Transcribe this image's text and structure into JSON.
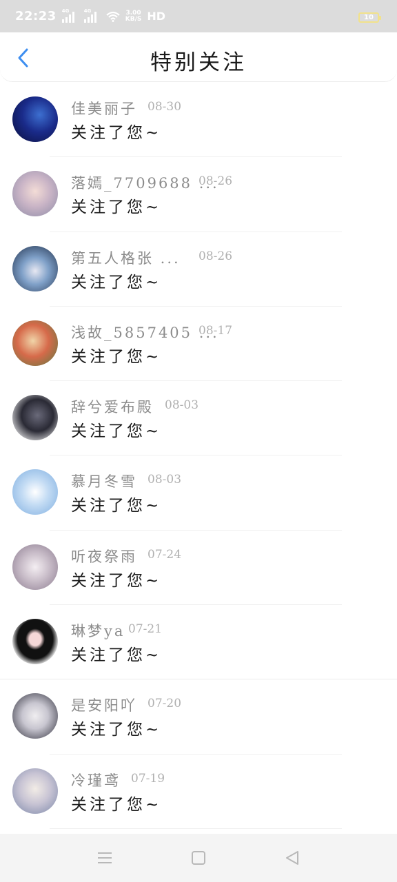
{
  "status_bar": {
    "time": "22:23",
    "signal1_tag": "4G",
    "signal2_tag": "4G",
    "speed_top": "3.00",
    "speed_bottom": "KB/S",
    "hd": "HD",
    "battery": "10"
  },
  "header": {
    "back_icon": "chevron-left-icon",
    "title": "特别关注"
  },
  "items": [
    {
      "name": "佳美丽子",
      "date": "08-30",
      "message": "关注了您~"
    },
    {
      "name": "落嫣_7709688 ...",
      "date": "08-26",
      "message": "关注了您~"
    },
    {
      "name": "第五人格张 ...",
      "date": "08-26",
      "message": "关注了您~"
    },
    {
      "name": "浅故_5857405 ...",
      "date": "08-17",
      "message": "关注了您~"
    },
    {
      "name": "辞兮爱布殿",
      "date": "08-03",
      "message": "关注了您~"
    },
    {
      "name": "慕月冬雪",
      "date": "08-03",
      "message": "关注了您~"
    },
    {
      "name": "听夜祭雨",
      "date": "07-24",
      "message": "关注了您~"
    },
    {
      "name": "琳梦ya",
      "date": "07-21",
      "message": "关注了您~"
    },
    {
      "name": "是安阳吖",
      "date": "07-20",
      "message": "关注了您~"
    },
    {
      "name": "冷瑾鸢",
      "date": "07-19",
      "message": "关注了您~"
    }
  ],
  "nav_bar": {
    "menu_icon": "menu-icon",
    "home_icon": "home-square-icon",
    "back_icon": "back-triangle-icon"
  },
  "colors": {
    "accent": "#3d8ef0",
    "status_bar": "#dcdcdc",
    "name_text": "#8c8c8c",
    "date_text": "#b0b0b0"
  }
}
